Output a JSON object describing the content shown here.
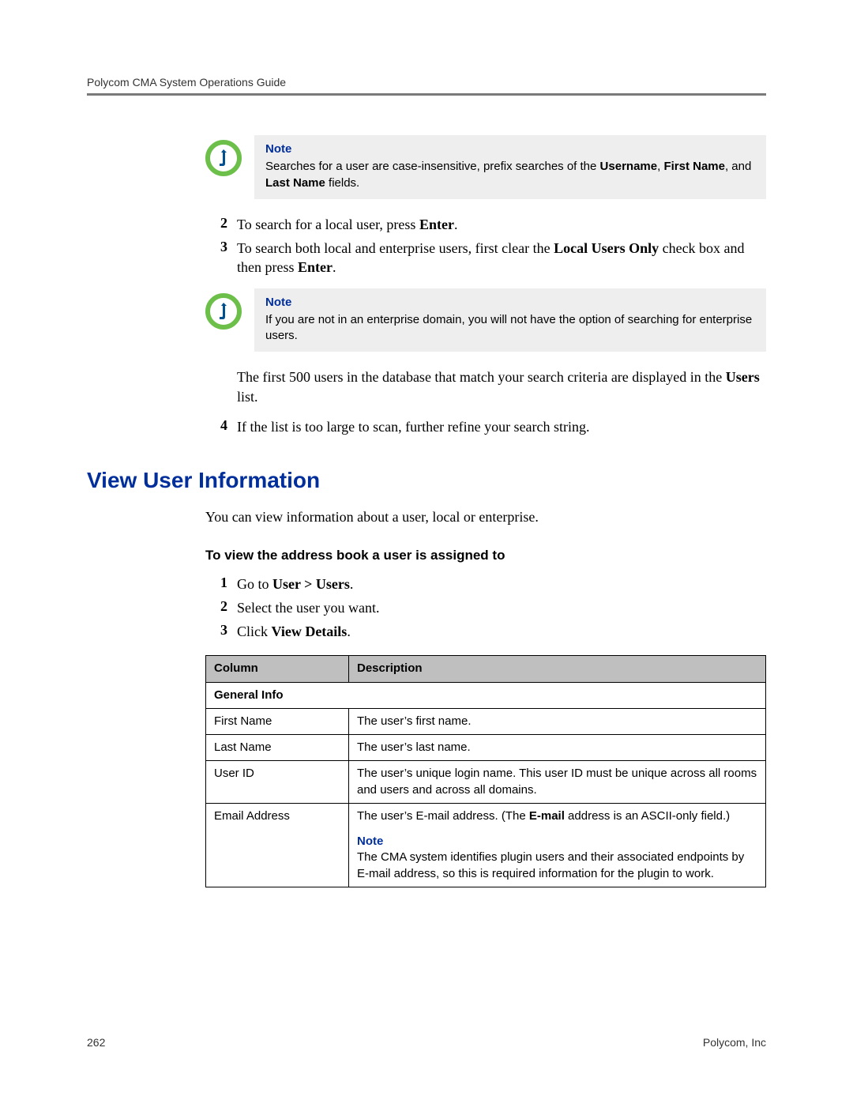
{
  "header": {
    "title": "Polycom CMA System Operations Guide"
  },
  "note1": {
    "title": "Note",
    "text_pre": "Searches for a user are case-insensitive, prefix searches of the ",
    "b1": "Username",
    "sep1": ", ",
    "b2": "First Name",
    "sep2": ", and ",
    "b3": "Last Name",
    "text_post": " fields."
  },
  "steps_a": {
    "s2_num": "2",
    "s2_pre": "To search for a local user, press ",
    "s2_b": "Enter",
    "s2_post": ".",
    "s3_num": "3",
    "s3_pre": "To search both local and enterprise users, first clear the ",
    "s3_b": "Local Users Only",
    "s3_mid": " check box and then press ",
    "s3_b2": "Enter",
    "s3_post": "."
  },
  "note2": {
    "title": "Note",
    "text": "If you are not in an enterprise domain, you will not have the option of searching for enterprise users."
  },
  "para1_pre": "The first 500 users in the database that match your search criteria are displayed in the ",
  "para1_b": "Users",
  "para1_post": " list.",
  "s4_num": "4",
  "s4_txt": "If the list is too large to scan, further refine your search string.",
  "h2": "View User Information",
  "intro": "You can view information about a user, local or enterprise.",
  "proc_title": "To view the address book a user is assigned to",
  "steps_b": {
    "s1_num": "1",
    "s1_pre": "Go to ",
    "s1_b": "User > Users",
    "s1_post": ".",
    "s2_num": "2",
    "s2_txt": "Select the user you want.",
    "s3_num": "3",
    "s3_pre": "Click ",
    "s3_b": "View Details",
    "s3_post": "."
  },
  "table": {
    "col1": "Column",
    "col2": "Description",
    "section": "General Info",
    "r1c1": "First Name",
    "r1c2": "The user’s first name.",
    "r2c1": "Last Name",
    "r2c2": "The user’s last name.",
    "r3c1": "User ID",
    "r3c2": "The user’s unique login name. This user ID must be unique across all rooms and users and across all domains.",
    "r4c1": "Email Address",
    "r4c2_pre": "The user’s E-mail address. (The ",
    "r4c2_b": "E-mail",
    "r4c2_post": " address is an ASCII-only field.)",
    "r4_note_title": "Note",
    "r4_note_text": "The CMA system identifies plugin users and their associated endpoints by E-mail address, so this is required information for the plugin to work."
  },
  "footer": {
    "page": "262",
    "company": "Polycom, Inc"
  }
}
